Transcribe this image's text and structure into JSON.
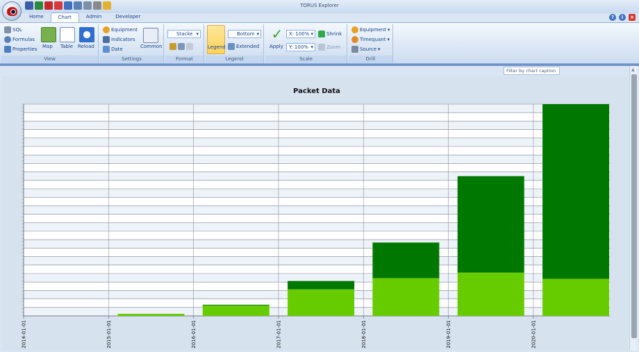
{
  "window": {
    "title": "TORUS Explorer"
  },
  "tabs": [
    {
      "label": "Home"
    },
    {
      "label": "Chart"
    },
    {
      "label": "Admin"
    },
    {
      "label": "Developer"
    }
  ],
  "ribbon": {
    "view": {
      "label": "View",
      "sql": "SQL",
      "formulas": "Formulas",
      "properties": "Properties",
      "map": "Map",
      "table": "Table",
      "reload": "Reload"
    },
    "settings": {
      "label": "Settings",
      "equipment": "Equipment",
      "indicators": "Indicators",
      "date": "Date",
      "common": "Common"
    },
    "format": {
      "label": "Format",
      "stack_combo": "Stacke"
    },
    "legend": {
      "label": "Legend",
      "legend": "Legend",
      "position_combo": "Bottom",
      "extended": "Extended"
    },
    "scale": {
      "label": "Scale",
      "apply": "Apply",
      "x_combo": "X: 100%",
      "y_combo": "Y: 100%",
      "shrink": "Shrink",
      "zoom": "Zoom"
    },
    "drill": {
      "label": "Drill",
      "equipment": "Equipment",
      "timequant": "Timequant",
      "source": "Source"
    }
  },
  "filter": {
    "placeholder": "Filter by chart caption"
  },
  "colors": {
    "dark": "#007800",
    "light": "#66cc00"
  },
  "chart_data": {
    "type": "bar",
    "title": "Packet Data",
    "stacked": true,
    "categories": [
      "2014-01-01",
      "2015-01-01",
      "2016-01-01",
      "2017-01-01",
      "2018-01-01",
      "2019-01-01",
      "2020-01-01"
    ],
    "series": [
      {
        "color": "#66cc00",
        "values": [
          0,
          3,
          15,
          38,
          54,
          62,
          53
        ]
      },
      {
        "color": "#007800",
        "values": [
          0,
          0,
          1,
          12,
          51,
          138,
          250
        ]
      }
    ],
    "ylim": [
      0,
      303
    ],
    "grid": true,
    "legend": "none"
  }
}
